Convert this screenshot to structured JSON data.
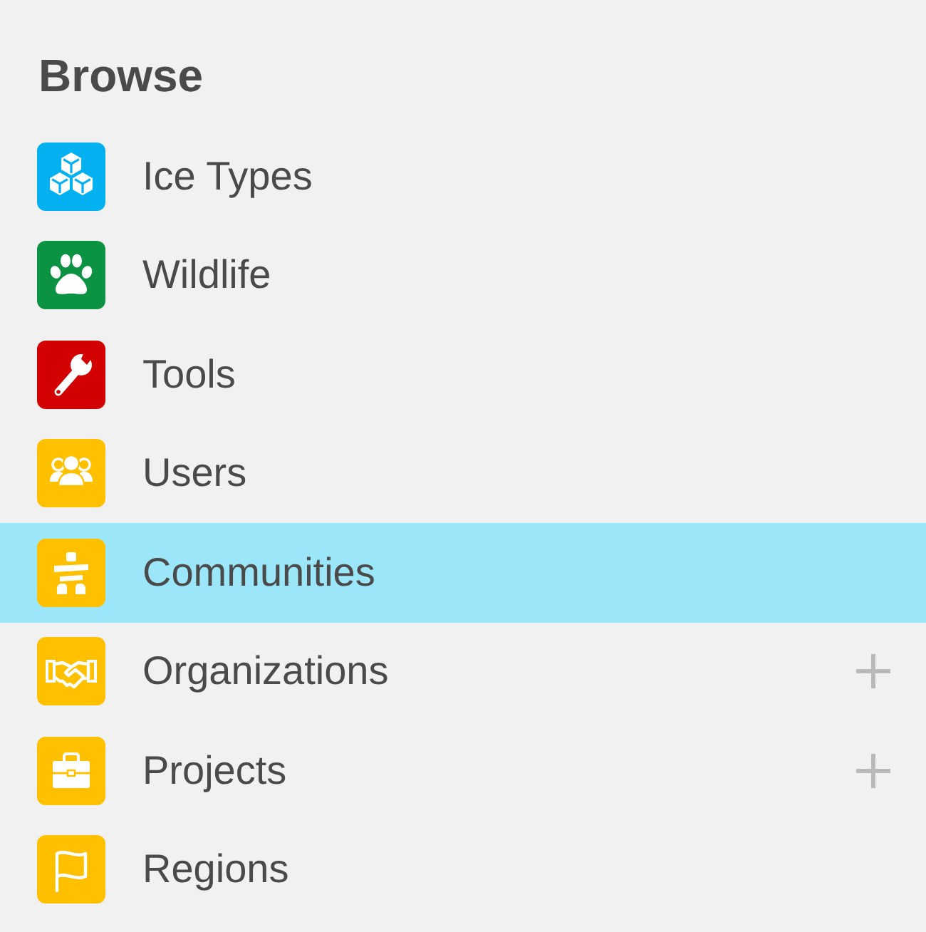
{
  "panel": {
    "title": "Browse"
  },
  "items": [
    {
      "label": "Ice Types",
      "color": "#03b1f1",
      "selected": false,
      "addable": false
    },
    {
      "label": "Wildlife",
      "color": "#0b9242",
      "selected": false,
      "addable": false
    },
    {
      "label": "Tools",
      "color": "#d20000",
      "selected": false,
      "addable": false
    },
    {
      "label": "Users",
      "color": "#ffc000",
      "selected": false,
      "addable": false
    },
    {
      "label": "Communities",
      "color": "#ffc000",
      "selected": true,
      "addable": false
    },
    {
      "label": "Organizations",
      "color": "#ffc000",
      "selected": false,
      "addable": true
    },
    {
      "label": "Projects",
      "color": "#ffc000",
      "selected": false,
      "addable": true
    },
    {
      "label": "Regions",
      "color": "#ffc000",
      "selected": false,
      "addable": false
    }
  ]
}
